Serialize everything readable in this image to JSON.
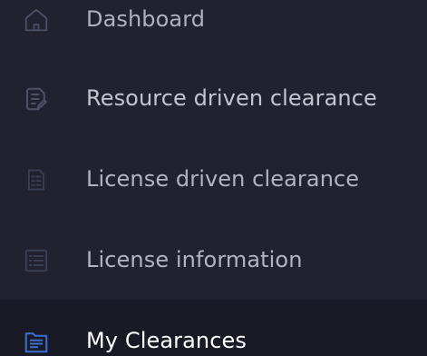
{
  "sidebar": {
    "items": [
      {
        "label": "Dashboard",
        "icon": "home-icon",
        "active": false
      },
      {
        "label": "Resource driven clearance",
        "icon": "document-edit-icon",
        "active": false
      },
      {
        "label": "License driven clearance",
        "icon": "document-list-icon",
        "active": false
      },
      {
        "label": "License information",
        "icon": "checklist-icon",
        "active": false
      },
      {
        "label": "My Clearances",
        "icon": "folder-document-icon",
        "active": true
      }
    ]
  },
  "colors": {
    "background": "#21212f",
    "active_background": "#1a1a26",
    "text": "#b0b1bc",
    "active_text": "#ffffff",
    "icon": "#4a4e63",
    "active_icon": "#3b6fd1"
  }
}
